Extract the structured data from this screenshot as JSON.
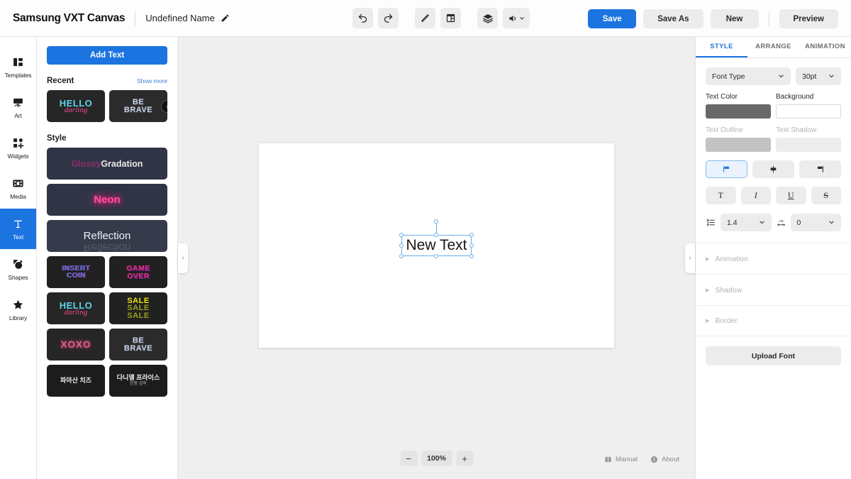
{
  "app": {
    "brand": "Samsung VXT Canvas",
    "document_name": "Undefined Name",
    "edit_icon": "pencil-icon"
  },
  "toolbar": {
    "undo": "undo-icon",
    "redo": "redo-icon",
    "ruler": "ruler-icon",
    "template": "template-icon",
    "layers": "layers-icon",
    "volume": "volume-icon"
  },
  "actions": {
    "save": "Save",
    "save_as": "Save As",
    "new": "New",
    "preview": "Preview"
  },
  "rail": {
    "items": [
      {
        "label": "Templates",
        "icon": "templates-icon",
        "active": false
      },
      {
        "label": "Art",
        "icon": "art-icon",
        "active": false
      },
      {
        "label": "Widgets",
        "icon": "widgets-icon",
        "active": false
      },
      {
        "label": "Media",
        "icon": "media-icon",
        "active": false
      },
      {
        "label": "Text",
        "icon": "text-icon",
        "active": true
      },
      {
        "label": "Shapes",
        "icon": "shapes-icon",
        "active": false
      },
      {
        "label": "Library",
        "icon": "library-icon",
        "active": false
      }
    ]
  },
  "text_panel": {
    "add_text": "Add Text",
    "recent_title": "Recent",
    "show_more": "Show more",
    "recent": [
      {
        "line1": "HELLO",
        "line2": "darling"
      },
      {
        "line1": "BE",
        "line2": "BRAVE"
      }
    ],
    "style_title": "Style",
    "styles": [
      {
        "name": "Glossy Gradation",
        "part1": "Glossy",
        "part2": "Gradation"
      },
      {
        "name": "Neon"
      },
      {
        "name": "Reflection"
      },
      {
        "name": "INSERT COIN",
        "line1": "INSERT",
        "line2": "COIN"
      },
      {
        "name": "GAME OVER",
        "line1": "GAME",
        "line2": "OVER"
      },
      {
        "name": "HELLO darling",
        "line1": "HELLO",
        "line2": "darling"
      },
      {
        "name": "SALE",
        "line1": "SALE",
        "line2": "SALE",
        "line3": "SALE"
      },
      {
        "name": "XOXO"
      },
      {
        "name": "BE BRAVE",
        "line1": "BE",
        "line2": "BRAVE"
      },
      {
        "name": "파마산 치즈",
        "sub": ""
      },
      {
        "name": "다니엘 프라이스",
        "sub": "민중 감독"
      }
    ]
  },
  "canvas": {
    "text_object": "New Text",
    "zoom_out": "−",
    "zoom_level": "100%",
    "zoom_in": "+",
    "collapse_left": "‹",
    "collapse_right": "›",
    "manual": "Manual",
    "about": "About"
  },
  "inspector": {
    "tabs": [
      {
        "label": "STYLE",
        "active": true
      },
      {
        "label": "ARRANGE",
        "active": false
      },
      {
        "label": "ANIMATION",
        "active": false
      }
    ],
    "font_type": "Font Type",
    "font_size": "30pt",
    "text_color_label": "Text Color",
    "background_label": "Background",
    "text_outline_label": "Text Outline",
    "text_shadow_label": "Text Shadow",
    "text_color_value": "#696969",
    "background_value": "#ffffff",
    "align": [
      {
        "name": "align-left",
        "active": true
      },
      {
        "name": "align-center",
        "active": false
      },
      {
        "name": "align-right",
        "active": false
      }
    ],
    "format": [
      {
        "name": "bold",
        "glyph": "T"
      },
      {
        "name": "italic",
        "glyph": "I"
      },
      {
        "name": "underline",
        "glyph": "U"
      },
      {
        "name": "strikethrough",
        "glyph": "S"
      }
    ],
    "line_height": "1.4",
    "letter_spacing": "0",
    "sections": [
      {
        "label": "Animation"
      },
      {
        "label": "Shadow"
      },
      {
        "label": "Border"
      }
    ],
    "upload_font": "Upload Font"
  },
  "colors": {
    "accent": "#1c74e0",
    "canvas_bg": "#efefef",
    "panel_bg": "#ffffff"
  }
}
